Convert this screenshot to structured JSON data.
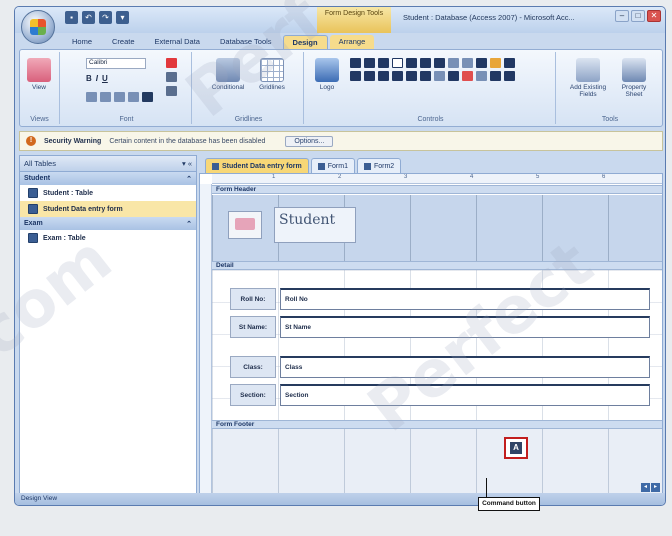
{
  "window": {
    "title": "Student : Database (Access 2007) - Microsoft Acc...",
    "context_tab_group": "Form Design Tools",
    "controls": [
      "–",
      "□",
      "✕"
    ]
  },
  "ribbon_tabs": [
    "Home",
    "Create",
    "External Data",
    "Database Tools",
    "Design",
    "Arrange"
  ],
  "ribbon": {
    "groups": [
      {
        "label": "Views",
        "buttons": [
          "View"
        ]
      },
      {
        "label": "Font",
        "buttons": [
          "Calibri",
          "B",
          "I",
          "U"
        ]
      },
      {
        "label": "Gridlines",
        "buttons": [
          "Conditional",
          "Gridlines"
        ]
      },
      {
        "label": "Controls",
        "buttons": [
          "Logo"
        ]
      },
      {
        "label": "Tools",
        "buttons": [
          "Add Existing Fields",
          "Property Sheet"
        ]
      }
    ]
  },
  "security_bar": {
    "title": "Security Warning",
    "message": "Certain content in the database has been disabled",
    "options": "Options..."
  },
  "nav_pane": {
    "header": "All Tables",
    "groups": [
      {
        "name": "Student",
        "items": [
          {
            "label": "Student : Table",
            "selected": false
          },
          {
            "label": "Student Data entry form",
            "selected": true
          }
        ]
      },
      {
        "name": "Exam",
        "items": [
          {
            "label": "Exam : Table",
            "selected": false
          }
        ]
      }
    ]
  },
  "doc_tabs": [
    {
      "label": "Student Data entry form",
      "active": true
    },
    {
      "label": "Form1",
      "active": false
    },
    {
      "label": "Form2",
      "active": false
    }
  ],
  "design": {
    "ruler_ticks": [
      "1",
      "2",
      "3",
      "4",
      "5",
      "6"
    ],
    "form_header_label": "Form Header",
    "header_title": "Student",
    "detail_label": "Detail",
    "fields": [
      {
        "label": "Roll No:",
        "control": "Roll No"
      },
      {
        "label": "St Name:",
        "control": "St Name"
      },
      {
        "label": "Class:",
        "control": "Class"
      },
      {
        "label": "Section:",
        "control": "Section"
      }
    ],
    "footer_label": "Form Footer",
    "command_button_callout": "Command button"
  },
  "status_bar": "Design View"
}
